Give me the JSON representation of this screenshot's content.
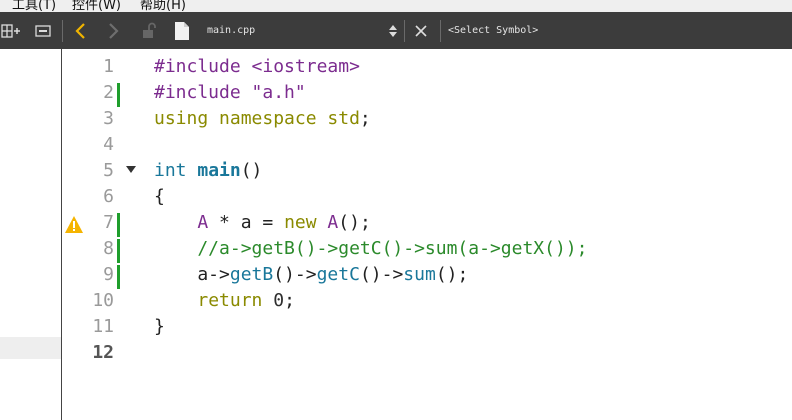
{
  "menubar": {
    "items": [
      "工具(T)",
      "控件(W)",
      "帮助(H)"
    ]
  },
  "toolbar": {
    "filename": "main.cpp",
    "symbol_placeholder": "<Select Symbol>"
  },
  "editor": {
    "current_line": 12,
    "warning_line": 7,
    "folded_line": 5,
    "changed_lines": [
      2,
      7,
      8,
      9
    ],
    "lines": [
      {
        "n": "1",
        "tokens": [
          {
            "t": "#include ",
            "c": "pp"
          },
          {
            "t": "<iostream>",
            "c": "str"
          }
        ]
      },
      {
        "n": "2",
        "tokens": [
          {
            "t": "#include ",
            "c": "pp"
          },
          {
            "t": "\"a.h\"",
            "c": "str"
          }
        ]
      },
      {
        "n": "3",
        "tokens": [
          {
            "t": "using namespace std",
            "c": "kw"
          },
          {
            "t": ";",
            "c": "plain"
          }
        ]
      },
      {
        "n": "4",
        "tokens": []
      },
      {
        "n": "5",
        "tokens": [
          {
            "t": "int ",
            "c": "type"
          },
          {
            "t": "main",
            "c": "fn"
          },
          {
            "t": "()",
            "c": "plain"
          }
        ]
      },
      {
        "n": "6",
        "tokens": [
          {
            "t": "{",
            "c": "plain"
          }
        ]
      },
      {
        "n": "7",
        "tokens": [
          {
            "t": "    ",
            "c": "plain"
          },
          {
            "t": "A",
            "c": "cls"
          },
          {
            "t": " * a = ",
            "c": "plain"
          },
          {
            "t": "new",
            "c": "kw"
          },
          {
            "t": " ",
            "c": "plain"
          },
          {
            "t": "A",
            "c": "cls"
          },
          {
            "t": "();",
            "c": "plain"
          }
        ]
      },
      {
        "n": "8",
        "tokens": [
          {
            "t": "    //a->getB()->getC()->sum(a->getX());",
            "c": "com"
          }
        ]
      },
      {
        "n": "9",
        "tokens": [
          {
            "t": "    a->",
            "c": "plain"
          },
          {
            "t": "getB",
            "c": "call"
          },
          {
            "t": "()->",
            "c": "plain"
          },
          {
            "t": "getC",
            "c": "call"
          },
          {
            "t": "()->",
            "c": "plain"
          },
          {
            "t": "sum",
            "c": "call"
          },
          {
            "t": "();",
            "c": "plain"
          }
        ]
      },
      {
        "n": "10",
        "tokens": [
          {
            "t": "    ",
            "c": "plain"
          },
          {
            "t": "return",
            "c": "ret"
          },
          {
            "t": " ",
            "c": "plain"
          },
          {
            "t": "0",
            "c": "num"
          },
          {
            "t": ";",
            "c": "plain"
          }
        ]
      },
      {
        "n": "11",
        "tokens": [
          {
            "t": "}",
            "c": "plain"
          }
        ]
      },
      {
        "n": "12",
        "tokens": []
      }
    ]
  }
}
